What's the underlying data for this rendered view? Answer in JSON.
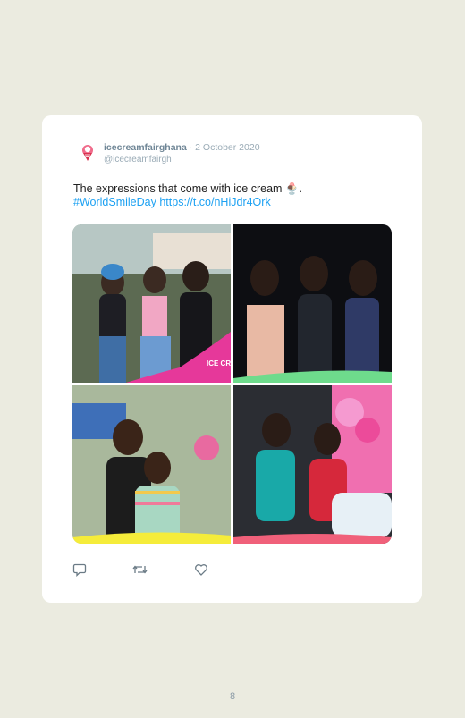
{
  "tweet": {
    "author_name": "icecreamfairghana",
    "separator": "·",
    "date": "2 October 2020",
    "handle": "@icecreamfairgh",
    "text": "The expressions that come with ice cream",
    "emoji": "🍨",
    "text_end": ".",
    "hashtag": "#WorldSmileDay",
    "link": "https://t.co/nHiJdr4Ork",
    "photos": [
      {
        "alt": "three women smiling outdoors",
        "logo": "ICE CREAM FAIR"
      },
      {
        "alt": "three women at night"
      },
      {
        "alt": "couple smiling"
      },
      {
        "alt": "two women with balloons"
      }
    ]
  },
  "actions": [
    {
      "icon": "reply-icon"
    },
    {
      "icon": "retweet-icon"
    },
    {
      "icon": "like-icon"
    }
  ],
  "page": {
    "number": "8"
  },
  "colors": {
    "background": "#ebebe0",
    "card": "#ffffff",
    "link": "#1da1f2",
    "name": "#6f8696"
  }
}
